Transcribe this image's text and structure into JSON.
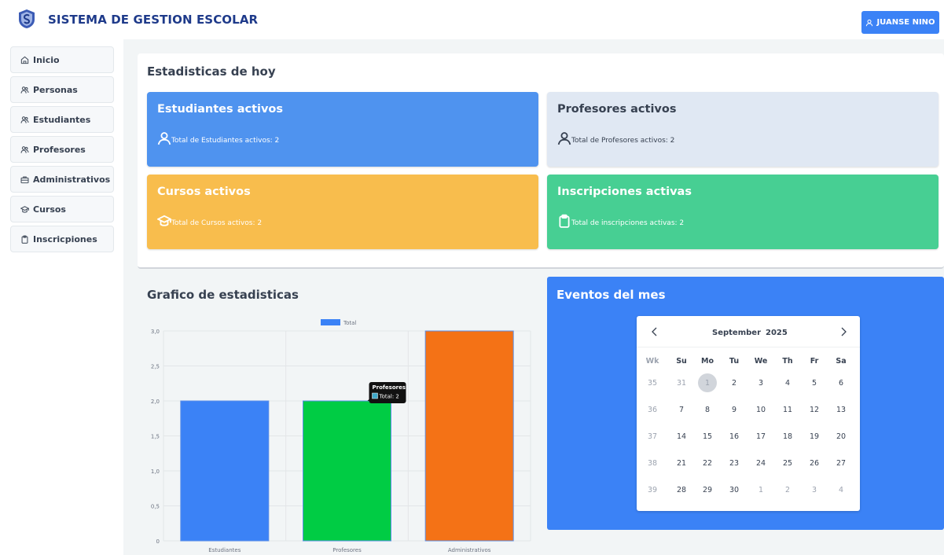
{
  "app": {
    "title": "SISTEMA DE GESTION ESCOLAR",
    "user_label": "JUANSE NINO",
    "brand_color": "#1e3a8a",
    "accent_color": "#3b82f6"
  },
  "sidebar": {
    "items": [
      {
        "label": "Inicio",
        "icon": "home-icon"
      },
      {
        "label": "Personas",
        "icon": "users-icon"
      },
      {
        "label": "Estudiantes",
        "icon": "users-icon"
      },
      {
        "label": "Profesores",
        "icon": "users-icon"
      },
      {
        "label": "Administrativos",
        "icon": "briefcase-icon"
      },
      {
        "label": "Cursos",
        "icon": "graduation-cap-icon"
      },
      {
        "label": "Inscricpiones",
        "icon": "clipboard-icon"
      }
    ]
  },
  "stats": {
    "title": "Estadisticas de hoy",
    "tiles": [
      {
        "title": "Estudiantes activos",
        "text": "Total de Estudiantes activos: 2",
        "icon": "user-icon",
        "color": "#4f93ef"
      },
      {
        "title": "Profesores activos",
        "text": "Total de Profesores activos: 2",
        "icon": "user-icon",
        "color": "#e0e8f3"
      },
      {
        "title": "Cursos activos",
        "text": "Total de Cursos activos: 2",
        "icon": "graduation-cap-icon",
        "color": "#f8bd4d"
      },
      {
        "title": "Inscripciones activas",
        "text": "Total de inscripciones activas: 2",
        "icon": "clipboard-icon",
        "color": "#47cf93"
      }
    ]
  },
  "graph": {
    "title": "Grafico de estadisticas"
  },
  "chart_data": {
    "type": "bar",
    "categories": [
      "Estudiantes",
      "Profesores",
      "Administrativos"
    ],
    "series": [
      {
        "name": "Total",
        "values": [
          2,
          2,
          3
        ]
      }
    ],
    "bar_colors": [
      "#3b82f6",
      "#00cc44",
      "#f47216"
    ],
    "legend_color": "#3b82f6",
    "ylim": [
      0,
      3
    ],
    "yticks": [
      "0",
      "0,5",
      "1,0",
      "1,5",
      "2,0",
      "2,5",
      "3,0"
    ],
    "legend_position": "top-center",
    "grid": true,
    "tooltip": {
      "title": "Profesores",
      "text": "Total: 2",
      "category_index": 1
    }
  },
  "events": {
    "title": "Eventos del mes",
    "calendar": {
      "month": "September",
      "year": "2025",
      "prev_icon": "chevron-left-icon",
      "next_icon": "chevron-right-icon",
      "headers": [
        "Wk",
        "Su",
        "Mo",
        "Tu",
        "We",
        "Th",
        "Fr",
        "Sa"
      ],
      "weeks": [
        {
          "wk": "35",
          "days": [
            "31",
            "1",
            "2",
            "3",
            "4",
            "5",
            "6"
          ]
        },
        {
          "wk": "36",
          "days": [
            "7",
            "8",
            "9",
            "10",
            "11",
            "12",
            "13"
          ]
        },
        {
          "wk": "37",
          "days": [
            "14",
            "15",
            "16",
            "17",
            "18",
            "19",
            "20"
          ]
        },
        {
          "wk": "38",
          "days": [
            "21",
            "22",
            "23",
            "24",
            "25",
            "26",
            "27"
          ]
        },
        {
          "wk": "39",
          "days": [
            "28",
            "29",
            "30",
            "1",
            "2",
            "3",
            "4"
          ]
        }
      ],
      "selected_day": "1"
    }
  }
}
